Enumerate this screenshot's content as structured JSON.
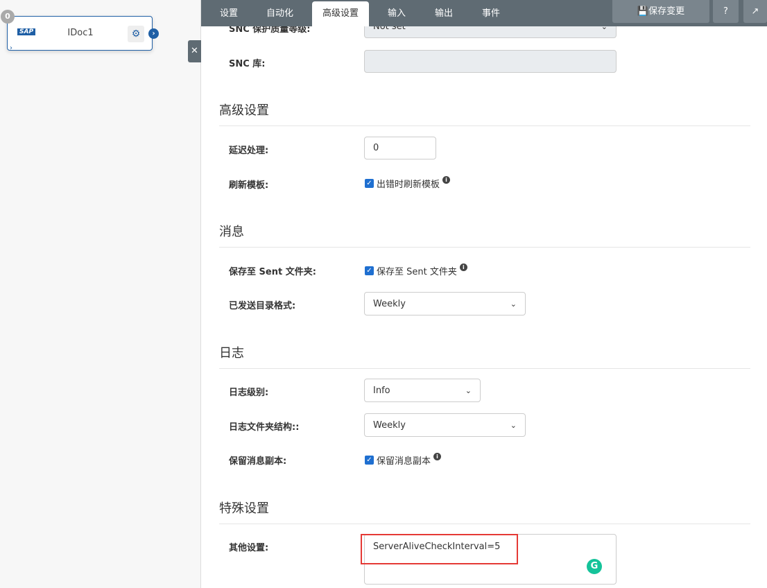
{
  "canvas": {
    "node": {
      "badge": "0",
      "logo": "SAP",
      "title": "IDoc1"
    }
  },
  "tabs": [
    "设置",
    "自动化",
    "高级设置",
    "输入",
    "输出",
    "事件"
  ],
  "toolbar": {
    "save": "保存变更",
    "help": "?",
    "external": "↗"
  },
  "snc": {
    "quality_label": "SNC 保护质量等级:",
    "quality_value": "Not set",
    "lib_label": "SNC 库:",
    "lib_value": ""
  },
  "advanced": {
    "heading": "高级设置",
    "delay_label": "延迟处理:",
    "delay_value": "0",
    "refresh_label": "刷新模板:",
    "refresh_cb": "出错时刷新模板"
  },
  "messages": {
    "heading": "消息",
    "sent_label": "保存至 Sent 文件夹:",
    "sent_cb": "保存至 Sent 文件夹",
    "format_label": "已发送目录格式:",
    "format_value": "Weekly"
  },
  "log": {
    "heading": "日志",
    "level_label": "日志级别:",
    "level_value": "Info",
    "folder_label": "日志文件夹结构::",
    "folder_value": "Weekly",
    "copy_label": "保留消息副本:",
    "copy_cb": "保留消息副本"
  },
  "special": {
    "heading": "特殊设置",
    "other_label": "其他设置:",
    "other_value": "ServerAliveCheckInterval=5"
  }
}
